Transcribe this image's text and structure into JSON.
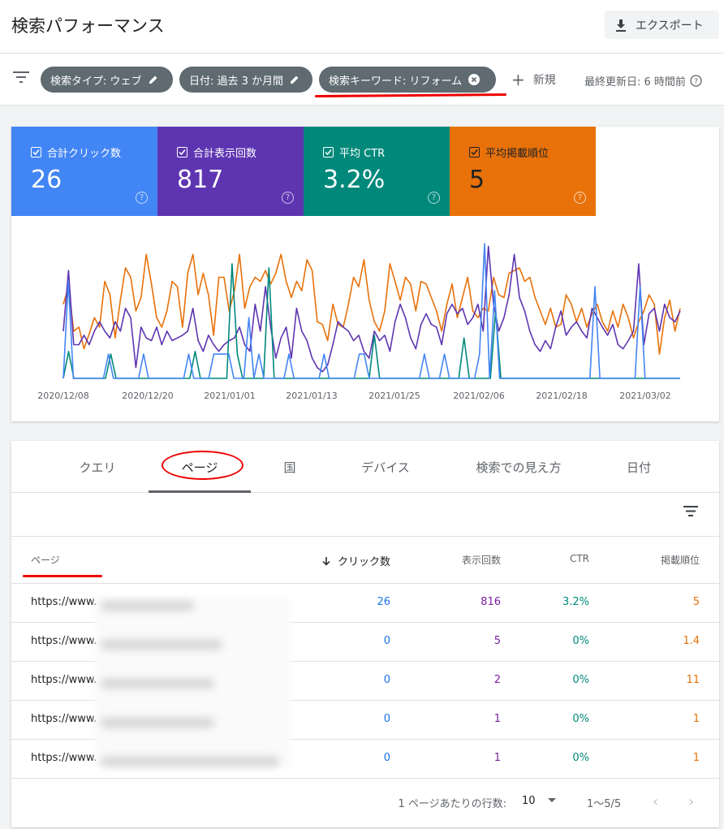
{
  "header": {
    "title": "検索パフォーマンス",
    "export_label": "エクスポート"
  },
  "filters": {
    "chips": [
      {
        "label": "検索タイプ: ウェブ",
        "icon": "pencil-icon"
      },
      {
        "label": "日付: 過去 3 か月間",
        "icon": "pencil-icon"
      },
      {
        "label": "検索キーワード: リフォーム",
        "icon": "close-circle-icon"
      }
    ],
    "add_label": "新規",
    "last_updated": "最終更新日: 6 時間前"
  },
  "metrics": [
    {
      "label": "合計クリック数",
      "value": "26",
      "color": "#4285f4"
    },
    {
      "label": "合計表示回数",
      "value": "817",
      "color": "#5e35b1"
    },
    {
      "label": "平均 CTR",
      "value": "3.2%",
      "color": "#00897b"
    },
    {
      "label": "平均掲載順位",
      "value": "5",
      "color": "#e8710a"
    }
  ],
  "chart_data": {
    "type": "line",
    "x_tick_labels": [
      "2020/12/08",
      "2020/12/20",
      "2021/01/01",
      "2021/01/13",
      "2021/01/25",
      "2021/02/06",
      "2021/02/18",
      "2021/03/02"
    ],
    "series": [
      {
        "color": "#e8710a",
        "values": [
          0.55,
          0.68,
          0.35,
          0.38,
          0.22,
          0.33,
          0.45,
          0.38,
          0.72,
          0.62,
          0.3,
          0.58,
          0.82,
          0.75,
          0.5,
          0.6,
          0.92,
          0.7,
          0.45,
          0.38,
          0.5,
          0.72,
          0.68,
          0.38,
          0.78,
          0.92,
          0.62,
          0.78,
          0.62,
          0.32,
          0.75,
          0.75,
          0.5,
          0.65,
          0.92,
          0.52,
          0.68,
          0.75,
          0.72,
          0.8,
          0.7,
          0.78,
          0.92,
          0.72,
          0.6,
          0.72,
          0.65,
          0.88,
          0.8,
          0.42,
          0.4,
          0.28,
          0.55,
          0.4,
          0.38,
          0.55,
          0.75,
          0.68,
          0.88,
          0.58,
          0.42,
          0.35,
          0.5,
          0.85,
          0.72,
          0.58,
          0.75,
          0.7,
          0.5,
          0.72,
          0.7,
          0.6,
          0.5,
          0.35,
          0.55,
          0.7,
          0.45,
          0.6,
          0.75,
          0.5,
          0.45,
          0.52,
          0.5,
          0.75,
          0.62,
          0.6,
          0.78,
          0.8,
          0.82,
          0.72,
          0.75,
          0.6,
          0.5,
          0.4,
          0.52,
          0.38,
          0.4,
          0.62,
          0.55,
          0.42,
          0.52,
          0.38,
          0.48,
          0.55,
          0.42,
          0.35,
          0.5,
          0.38,
          0.55,
          0.45,
          0.3,
          0.42,
          0.5,
          0.62,
          0.55,
          0.18,
          0.45,
          0.58,
          0.35,
          0.52
        ]
      },
      {
        "color": "#5e35b1",
        "values": [
          0.35,
          0.8,
          0.25,
          0.25,
          0.32,
          0.25,
          0.35,
          0.42,
          0.35,
          0.3,
          0.42,
          0.35,
          0.52,
          0.45,
          0.08,
          0.38,
          0.3,
          0.28,
          0.38,
          0.25,
          0.35,
          0.28,
          0.3,
          0.32,
          0.35,
          0.52,
          0.28,
          0.2,
          0.32,
          0.25,
          0.2,
          0.25,
          0.28,
          0.3,
          0.38,
          0.25,
          0.2,
          0.55,
          0.35,
          0.68,
          0.38,
          0.15,
          0.3,
          0.38,
          0.15,
          0.52,
          0.35,
          0.28,
          0.15,
          0.08,
          0.05,
          0.1,
          0.25,
          0.42,
          0.38,
          0.35,
          0.28,
          0.32,
          0.2,
          0.15,
          0.35,
          0.28,
          0.32,
          0.2,
          0.42,
          0.55,
          0.45,
          0.3,
          0.22,
          0.4,
          0.48,
          0.4,
          0.38,
          0.25,
          0.48,
          0.55,
          0.48,
          0.52,
          0.4,
          0.45,
          0.55,
          0.35,
          0.98,
          0.55,
          0.35,
          0.45,
          0.62,
          0.92,
          0.6,
          0.5,
          0.35,
          0.25,
          0.2,
          0.28,
          0.22,
          0.38,
          0.5,
          0.32,
          0.38,
          0.42,
          0.35,
          0.3,
          0.52,
          0.45,
          0.38,
          0.32,
          0.4,
          0.25,
          0.22,
          0.28,
          0.35,
          0.85,
          0.25,
          0.48,
          0.52,
          0.35,
          0.55,
          0.45,
          0.42,
          0.5
        ]
      },
      {
        "color": "#00897b",
        "values": [
          0,
          0.2,
          0,
          0,
          0,
          0,
          0,
          0,
          0,
          0.18,
          0,
          0,
          0,
          0,
          0,
          0,
          0,
          0,
          0,
          0,
          0,
          0,
          0,
          0,
          0,
          0.2,
          0,
          0,
          0,
          0,
          0,
          0,
          0.85,
          0.18,
          0,
          0,
          0,
          0,
          0,
          0.82,
          0,
          0,
          0,
          0,
          0,
          0,
          0,
          0,
          0,
          0,
          0,
          0,
          0,
          0,
          0,
          0,
          0,
          0,
          0,
          0.32,
          0,
          0,
          0,
          0,
          0,
          0,
          0,
          0,
          0,
          0,
          0,
          0,
          0,
          0,
          0,
          0,
          0.3,
          0,
          0,
          0,
          0,
          0,
          0.5,
          0,
          0,
          0,
          0,
          0,
          0,
          0,
          0,
          0,
          0,
          0,
          0,
          0,
          0,
          0,
          0,
          0,
          0,
          0,
          0,
          0,
          0,
          0,
          0,
          0,
          0,
          0,
          0,
          0,
          0,
          0,
          0,
          0,
          0,
          0
        ]
      },
      {
        "color": "#4285f4",
        "values": [
          0,
          0.72,
          0,
          0,
          0,
          0,
          0,
          0,
          0,
          0.18,
          0,
          0,
          0,
          0,
          0,
          0,
          0.18,
          0,
          0,
          0,
          0,
          0,
          0,
          0,
          0,
          0.18,
          0,
          0,
          0,
          0,
          0.18,
          0.18,
          0.18,
          0.18,
          0,
          0,
          0,
          0.45,
          0,
          0.18,
          0,
          0,
          0,
          0,
          0,
          0.18,
          0,
          0,
          0,
          0,
          0,
          0,
          0.18,
          0,
          0,
          0,
          0,
          0,
          0,
          0.18,
          0.18,
          0,
          0,
          0,
          0,
          0,
          0,
          0,
          0,
          0,
          0,
          0,
          0.18,
          0,
          0,
          0,
          0.18,
          0,
          0,
          0,
          0,
          0,
          0,
          0.18,
          1.0,
          0,
          0.65,
          0,
          0,
          0,
          0,
          0,
          0,
          0,
          0,
          0,
          0,
          0,
          0,
          0,
          0,
          0,
          0,
          0,
          0,
          0,
          0.68,
          0,
          0,
          0,
          0,
          0,
          0,
          0,
          0,
          0.68,
          0,
          0,
          0,
          0,
          0,
          0,
          0,
          0
        ]
      }
    ]
  },
  "tabs": [
    "クエリ",
    "ページ",
    "国",
    "デバイス",
    "検索での見え方",
    "日付"
  ],
  "table": {
    "headers": {
      "page": "ページ",
      "clicks": "クリック数",
      "impressions": "表示回数",
      "ctr": "CTR",
      "position": "掲載順位"
    },
    "rows": [
      {
        "url": "https://www.",
        "clicks": "26",
        "impressions": "816",
        "ctr": "3.2%",
        "position": "5"
      },
      {
        "url": "https://www.",
        "clicks": "0",
        "impressions": "5",
        "ctr": "0%",
        "position": "1.4"
      },
      {
        "url": "https://www.",
        "clicks": "0",
        "impressions": "2",
        "ctr": "0%",
        "position": "11"
      },
      {
        "url": "https://www.",
        "clicks": "0",
        "impressions": "1",
        "ctr": "0%",
        "position": "1"
      },
      {
        "url": "https://www.",
        "clicks": "0",
        "impressions": "1",
        "ctr": "0%",
        "position": "1"
      }
    ]
  },
  "pagination": {
    "rows_label": "1 ページあたりの行数:",
    "rows_value": "10",
    "range": "1〜5/5"
  }
}
